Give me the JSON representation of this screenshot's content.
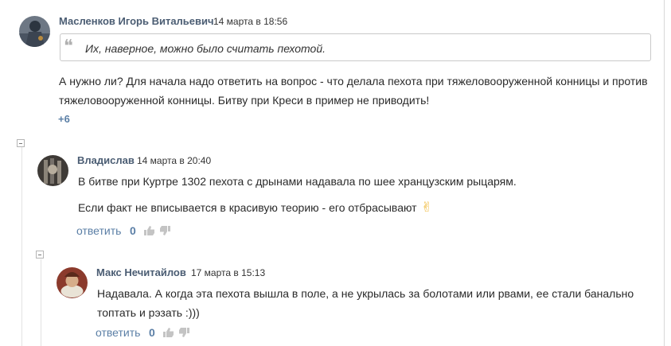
{
  "comments": [
    {
      "author": "Масленков Игорь Витальевич",
      "date": "14 марта в 18:56",
      "quote": "Их, наверное, можно было считать пехотой.",
      "text": "А нужно ли? Для начала надо ответить на вопрос - что делала пехота при тяжеловооруженной конницы и против тяжеловооруженной конницы. Битву при Креси в пример не приводить!",
      "score": "+6"
    },
    {
      "author": "Владислав",
      "date": "14 марта в 20:40",
      "paragraphs": [
        "В битве при Куртре 1302 пехота с дрынами надавала по шее хранцузским рыцарям.",
        "Если факт не вписывается в красивую теорию - его отбрасывают"
      ],
      "emoji": "✌",
      "reply_label": "ответить",
      "score": "0"
    },
    {
      "author": "Макс Нечитайлов",
      "date": "17 марта в 15:13",
      "text": "Надавала. А когда эта пехота вышла в поле, а не укрылась за болотами или рвами, ее стали банально топтать и рэзать :)))",
      "reply_label": "ответить",
      "score": "0"
    }
  ],
  "icons": {
    "quote": "quote-mark-icon",
    "like": "thumb-up-icon",
    "dislike": "thumb-down-icon",
    "collapse": "collapse-minus-icon"
  },
  "colors": {
    "author": "#4b5d73",
    "link": "#5b7fa6",
    "emoji": "#f0b93a"
  }
}
